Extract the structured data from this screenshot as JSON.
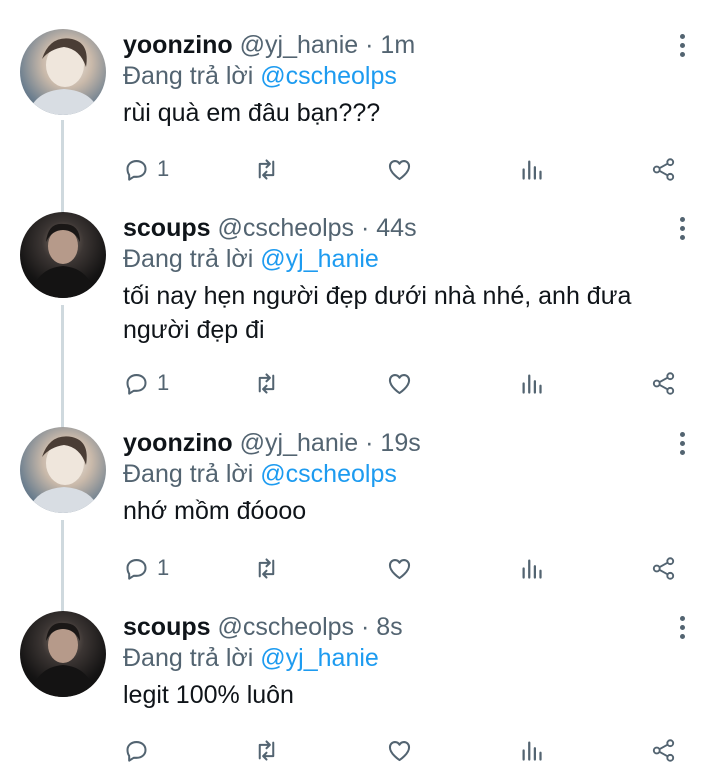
{
  "tweets": [
    {
      "name": "yoonzino",
      "handle": "@yj_hanie",
      "time": "1m",
      "reply_prefix": "Đang trả lời",
      "reply_to": "@cscheolps",
      "text": "rùi quà em đâu bạn???",
      "reply_count": "1",
      "avatar_style": "light"
    },
    {
      "name": "scoups",
      "handle": "@cscheolps",
      "time": "44s",
      "reply_prefix": "Đang trả lời",
      "reply_to": "@yj_hanie",
      "text": "tối nay hẹn người đẹp dưới nhà nhé, anh đưa người đẹp đi",
      "reply_count": "1",
      "avatar_style": "dark"
    },
    {
      "name": "yoonzino",
      "handle": "@yj_hanie",
      "time": "19s",
      "reply_prefix": "Đang trả lời",
      "reply_to": "@cscheolps",
      "text": "nhớ mồm đóooo",
      "reply_count": "1",
      "avatar_style": "light"
    },
    {
      "name": "scoups",
      "handle": "@cscheolps",
      "time": "8s",
      "reply_prefix": "Đang trả lời",
      "reply_to": "@yj_hanie",
      "text": "legit 100% luôn",
      "reply_count": "",
      "avatar_style": "dark"
    }
  ],
  "separator": "·",
  "colors": {
    "text": "#0f1419",
    "secondary": "#536471",
    "mention": "#1d9bf0",
    "thread_line": "#cfd9de"
  },
  "icons": [
    "reply-icon",
    "retweet-icon",
    "like-icon",
    "analytics-icon",
    "share-icon",
    "more-icon"
  ]
}
